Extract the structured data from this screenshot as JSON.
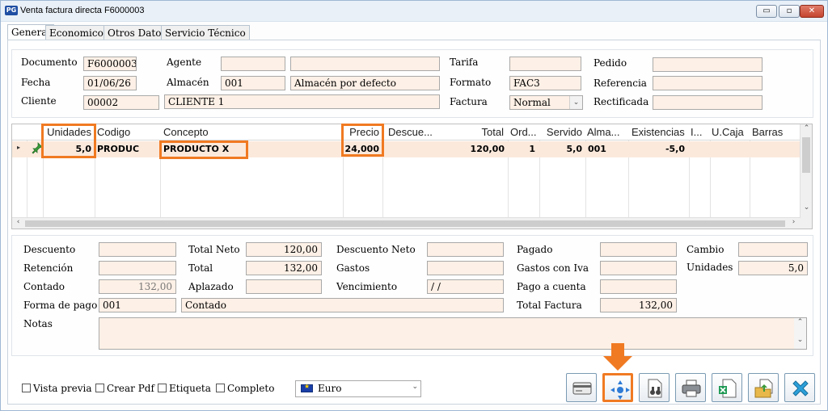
{
  "window": {
    "title": "Venta factura directa F6000003",
    "logo_text": "PG",
    "btn_min": "▭",
    "btn_max": "▫",
    "btn_close": "✕"
  },
  "tabs": [
    "General",
    "Economicos",
    "Otros Datos",
    "Servicio Técnico"
  ],
  "header": {
    "documento_label": "Documento",
    "documento": "F6000003",
    "fecha_label": "Fecha",
    "fecha": "01/06/26",
    "cliente_label": "Cliente",
    "cliente_code": "00002",
    "cliente_name": "CLIENTE 1",
    "agente_label": "Agente",
    "agente_code": "",
    "agente_name": "",
    "almacen_label": "Almacén",
    "almacen_code": "001",
    "almacen_name": "Almacén por defecto",
    "tarifa_label": "Tarifa",
    "tarifa": "",
    "formato_label": "Formato",
    "formato": "FAC3",
    "factura_label": "Factura",
    "factura": "Normal",
    "pedido_label": "Pedido",
    "pedido": "",
    "referencia_label": "Referencia",
    "referencia": "",
    "rectificada_label": "Rectificada",
    "rectificada": ""
  },
  "grid": {
    "columns": [
      "Unidades",
      "Codigo",
      "Concepto",
      "Precio",
      "Descue...",
      "Total",
      "Ord...",
      "Servido",
      "Alma...",
      "Existencias",
      "I...",
      "U.Caja",
      "Barras"
    ],
    "row": {
      "unidades": "5,0",
      "codigo": "PRODUC",
      "concepto": "PRODUCTO X",
      "precio": "24,000",
      "descuento": "",
      "total": "120,00",
      "orden": "1",
      "servido": "5,0",
      "almacen": "001",
      "existencias": "-5,0",
      "i": "",
      "ucaja": "",
      "barras": ""
    },
    "row_indicator": "▸",
    "scroll_up": "⌃",
    "scroll_down": "⌄",
    "scroll_left": "‹",
    "scroll_right": "›"
  },
  "totals": {
    "descuento_label": "Descuento",
    "descuento": "",
    "retencion_label": "Retención",
    "retencion": "",
    "contado_label": "Contado",
    "contado": "132,00",
    "forma_pago_label": "Forma de pago",
    "forma_pago_code": "001",
    "forma_pago_name": "Contado",
    "total_neto_label": "Total Neto",
    "total_neto": "120,00",
    "total_label": "Total",
    "total": "132,00",
    "aplazado_label": "Aplazado",
    "aplazado": "",
    "descuento_neto_label": "Descuento Neto",
    "descuento_neto": "",
    "gastos_label": "Gastos",
    "gastos": "",
    "vencimiento_label": "Vencimiento",
    "vencimiento": " /  /",
    "pagado_label": "Pagado",
    "pagado": "",
    "gastos_iva_label": "Gastos con Iva",
    "gastos_iva": "",
    "pago_cuenta_label": "Pago a cuenta",
    "pago_cuenta": "",
    "total_factura_label": "Total Factura",
    "total_factura": "132,00",
    "cambio_label": "Cambio",
    "cambio": "",
    "unidades_label": "Unidades",
    "unidades": "5,0",
    "notas_label": "Notas",
    "notas": ""
  },
  "bottom": {
    "vista_previa": "Vista previa",
    "crear_pdf": "Crear Pdf",
    "etiqueta": "Etiqueta",
    "completo": "Completo",
    "currency": "Euro",
    "dropdown_glyph": "⌄"
  },
  "colors": {
    "highlight": "#f07a22",
    "field_bg": "#fdf0e6",
    "row_bg": "#fbe9dc"
  }
}
